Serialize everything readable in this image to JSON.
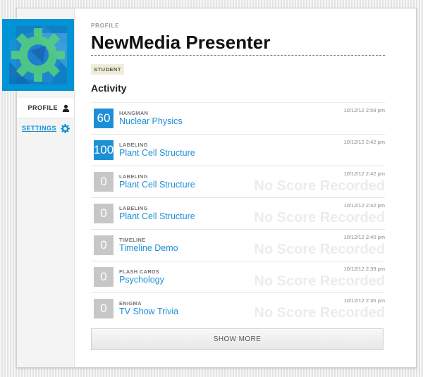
{
  "profile": {
    "section_label": "PROFILE",
    "name": "NewMedia Presenter",
    "role_badge": "STUDENT"
  },
  "sidebar": {
    "items": [
      {
        "label": "PROFILE",
        "icon": "user-icon"
      },
      {
        "label": "SETTINGS",
        "icon": "gear-icon"
      }
    ]
  },
  "activity": {
    "heading": "Activity",
    "rows": [
      {
        "score": "60",
        "has_score": true,
        "type": "HANGMAN",
        "title": "Nuclear Physics",
        "time": "10/12/12 2:59 pm",
        "no_score": ""
      },
      {
        "score": "100",
        "has_score": true,
        "type": "LABELING",
        "title": "Plant Cell Structure",
        "time": "10/12/12 2:42 pm",
        "no_score": ""
      },
      {
        "score": "0",
        "has_score": false,
        "type": "LABELING",
        "title": "Plant Cell Structure",
        "time": "10/12/12 2:42 pm",
        "no_score": "No Score Recorded"
      },
      {
        "score": "0",
        "has_score": false,
        "type": "LABELING",
        "title": "Plant Cell Structure",
        "time": "10/12/12 2:42 pm",
        "no_score": "No Score Recorded"
      },
      {
        "score": "0",
        "has_score": false,
        "type": "TIMELINE",
        "title": "Timeline Demo",
        "time": "10/12/12 2:40 pm",
        "no_score": "No Score Recorded"
      },
      {
        "score": "0",
        "has_score": false,
        "type": "FLASH CARDS",
        "title": "Psychology",
        "time": "10/12/12 2:39 pm",
        "no_score": "No Score Recorded"
      },
      {
        "score": "0",
        "has_score": false,
        "type": "ENIGMA",
        "title": "TV Show Trivia",
        "time": "10/12/12 2:35 pm",
        "no_score": "No Score Recorded"
      }
    ],
    "show_more_label": "SHOW MORE"
  },
  "colors": {
    "accent": "#1d8fd7",
    "avatar_bg": "#0093d6",
    "gear": "#4fd06a",
    "score_empty": "#c7c7c7"
  }
}
